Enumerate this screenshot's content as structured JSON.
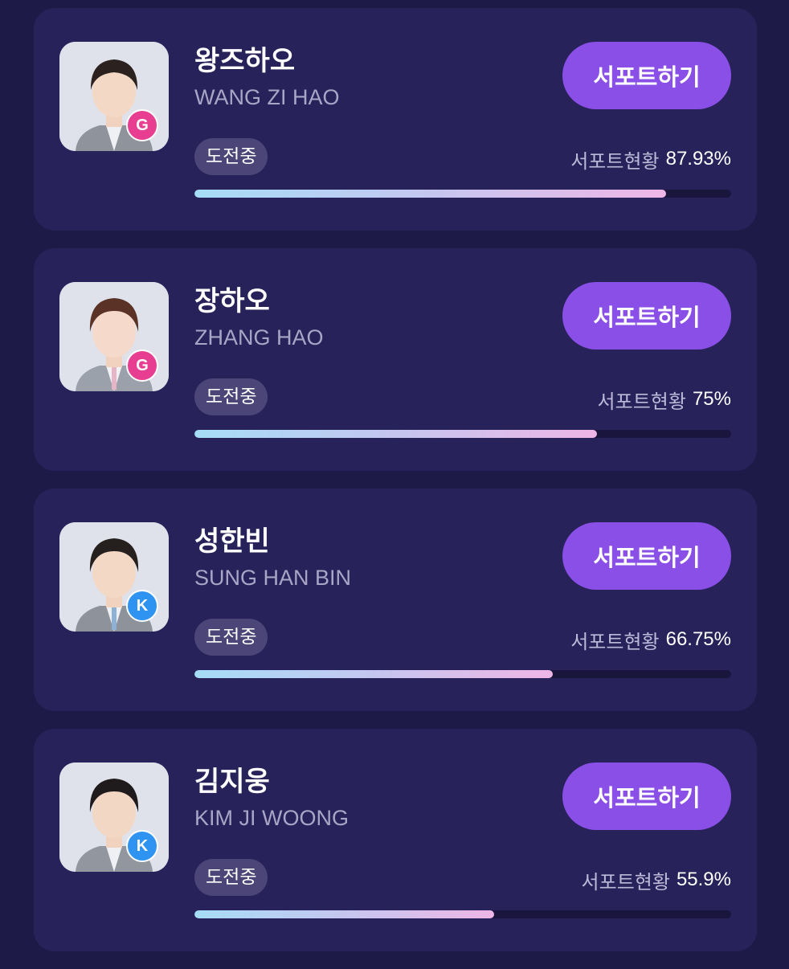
{
  "support_button_label": "서포트하기",
  "status_label": "도전중",
  "support_status_label": "서포트현황",
  "colors": {
    "background": "#1e1a47",
    "card": "#28225a",
    "button": "#8a4fe6",
    "badge_g": "#e73e91",
    "badge_k": "#2f93f1"
  },
  "trainees": [
    {
      "name_ko": "왕즈하오",
      "name_en": "WANG ZI HAO",
      "group_badge": "G",
      "badge_color": "#e73e91",
      "support_percent_label": "87.93%",
      "support_progress": 87.93,
      "icon": "trainee-photo"
    },
    {
      "name_ko": "장하오",
      "name_en": "ZHANG HAO",
      "group_badge": "G",
      "badge_color": "#e73e91",
      "support_percent_label": "75%",
      "support_progress": 75,
      "icon": "trainee-photo"
    },
    {
      "name_ko": "성한빈",
      "name_en": "SUNG HAN BIN",
      "group_badge": "K",
      "badge_color": "#2f93f1",
      "support_percent_label": "66.75%",
      "support_progress": 66.75,
      "icon": "trainee-photo"
    },
    {
      "name_ko": "김지웅",
      "name_en": "KIM JI WOONG",
      "group_badge": "K",
      "badge_color": "#2f93f1",
      "support_percent_label": "55.9%",
      "support_progress": 55.9,
      "icon": "trainee-photo"
    }
  ]
}
